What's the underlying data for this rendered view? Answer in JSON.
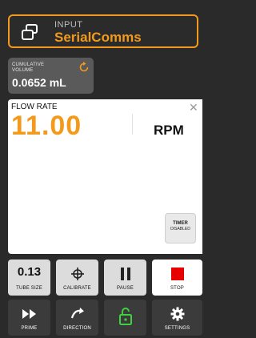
{
  "input": {
    "label": "INPUT",
    "value": "SerialComms"
  },
  "volume": {
    "label_line1": "CUMULATIVE",
    "label_line2": "VOLUME",
    "value": "0.0652 mL"
  },
  "flow": {
    "label": "FLOW RATE",
    "value": "11.00",
    "unit": "RPM",
    "close": "✕"
  },
  "timer": {
    "line1": "TIMER",
    "line2": "DISABLED"
  },
  "controls": {
    "tube_size_value": "0.13",
    "tube_size_label": "TUBE SIZE",
    "calibrate_label": "CALIBRATE",
    "pause_label": "PAUSE",
    "stop_label": "STOP",
    "prime_label": "PRIME",
    "direction_label": "DIRECTION",
    "settings_label": "SETTINGS"
  },
  "colors": {
    "accent": "#f39a1c",
    "stop": "#e60000",
    "lock": "#3fd23f",
    "background": "#2a2a2a"
  }
}
